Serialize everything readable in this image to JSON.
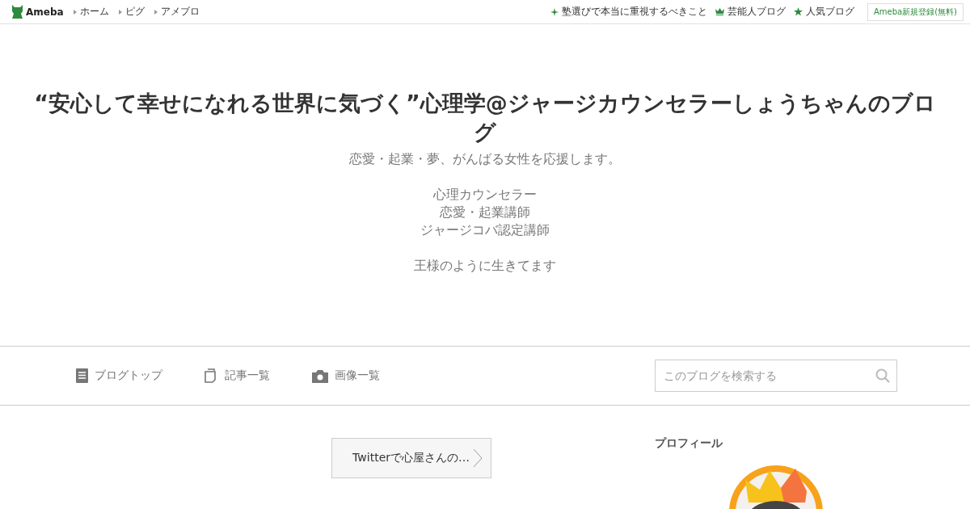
{
  "top_bar": {
    "logo": "Ameba",
    "links": [
      {
        "label": "ホーム"
      },
      {
        "label": "ピグ"
      },
      {
        "label": "アメブロ"
      }
    ],
    "right_links": [
      {
        "kind": "sparkle",
        "label": "塾選びで本当に重視するべきこと"
      },
      {
        "kind": "crown",
        "label": "芸能人ブログ"
      },
      {
        "kind": "star",
        "label": "人気ブログ"
      }
    ],
    "register_button": "Ameba新規登録(無料)"
  },
  "blog_header": {
    "title": "“安心して幸せになれる世界に気づく”心理学@ジャージカウンセラーしょうちゃんのブログ",
    "description_paragraphs": [
      [
        "恋愛・起業・夢、がんばる女性を応援します。"
      ],
      [
        "心理カウンセラー",
        "恋愛・起業講師",
        "ジャージコバ認定講師"
      ],
      [
        "王様のように生きてます"
      ]
    ]
  },
  "blog_nav": {
    "items": [
      {
        "kind": "top",
        "label": "ブログトップ"
      },
      {
        "kind": "entries",
        "label": "記事一覧"
      },
      {
        "kind": "images",
        "label": "画像一覧"
      }
    ],
    "search": {
      "placeholder": "このブログを検索する"
    }
  },
  "main": {
    "next_entry": "Twitterで心屋さんの…"
  },
  "sidebar": {
    "heading": "プロフィール"
  }
}
